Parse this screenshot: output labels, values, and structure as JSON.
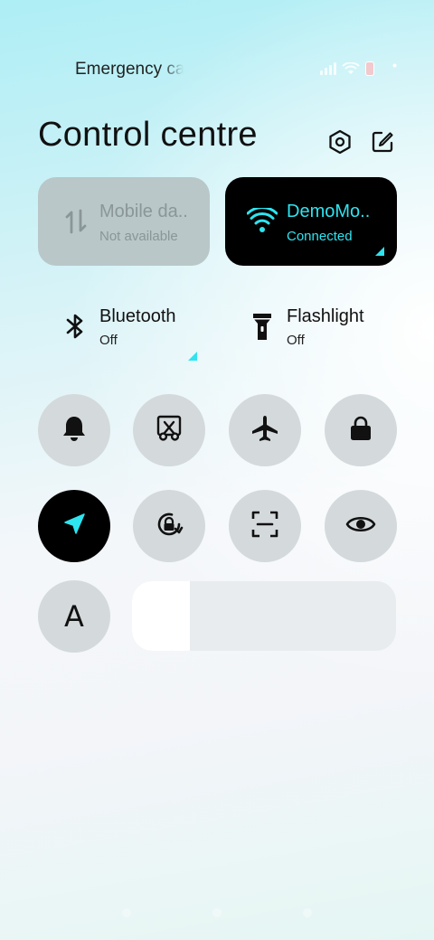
{
  "status_bar": {
    "carrier_text": "Emergency calls only",
    "icons": [
      "signal-icon",
      "wifi-icon",
      "battery-icon",
      "dot-icon"
    ]
  },
  "header": {
    "title": "Control centre",
    "settings_icon": "hexagon-settings-icon",
    "edit_icon": "edit-icon"
  },
  "tiles": {
    "mobile_data": {
      "label": "Mobile da..",
      "status": "Not available",
      "icon": "data-arrows-icon"
    },
    "wifi": {
      "label": "DemoMo..",
      "status": "Connected",
      "icon": "wifi-icon"
    },
    "bluetooth": {
      "label": "Bluetooth",
      "status": "Off",
      "icon": "bluetooth-icon"
    },
    "flashlight": {
      "label": "Flashlight",
      "status": "Off",
      "icon": "flashlight-icon"
    }
  },
  "toggles": [
    {
      "name": "bell-icon",
      "active": false
    },
    {
      "name": "screenshot-icon",
      "active": false
    },
    {
      "name": "airplane-icon",
      "active": false
    },
    {
      "name": "lock-icon",
      "active": false
    },
    {
      "name": "location-icon",
      "active": true
    },
    {
      "name": "rotation-lock-icon",
      "active": false
    },
    {
      "name": "scan-icon",
      "active": false
    },
    {
      "name": "eye-icon",
      "active": false
    }
  ],
  "text_size_button": {
    "label": "A"
  },
  "brightness": {
    "level_fraction": 0.22
  },
  "colors": {
    "accent": "#2ee4f0",
    "active_tile": "#000000",
    "inactive_circle": "#d4d9db",
    "disabled_tile": "#b9c7c9"
  }
}
